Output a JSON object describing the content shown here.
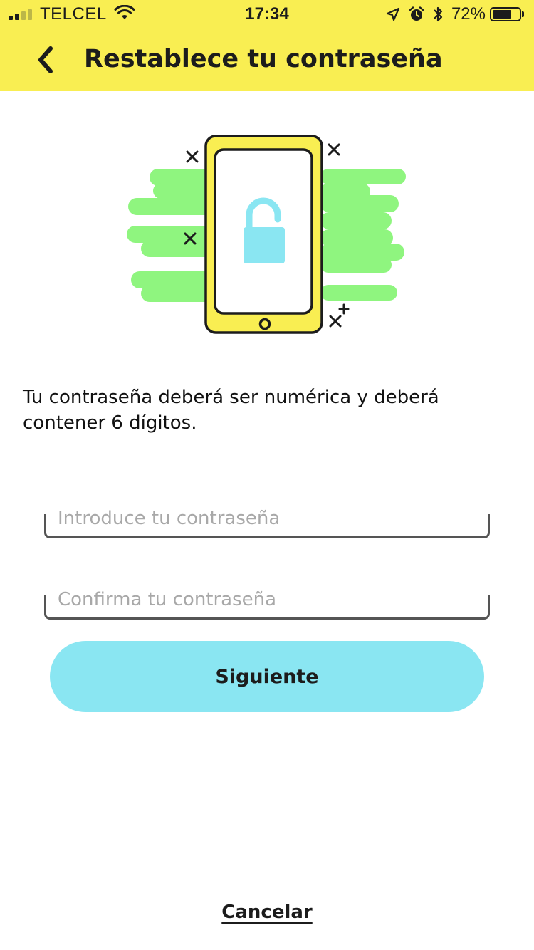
{
  "status_bar": {
    "carrier": "TELCEL",
    "time": "17:34",
    "battery_percent_label": "72%",
    "battery_level": 0.72,
    "signal_bars_filled": 2,
    "signal_bars_total": 4,
    "icons": [
      "signal-icon",
      "wifi-icon",
      "location-arrow-icon",
      "alarm-icon",
      "bluetooth-icon",
      "battery-icon"
    ]
  },
  "header": {
    "title": "Restablece tu contraseña",
    "back_icon": "chevron-left-icon",
    "background_color": "#f9ee52"
  },
  "illustration": {
    "description_icon": "unlocked-phone-icon"
  },
  "instructions": "Tu contraseña deberá ser numérica y deberá contener 6 dígitos.",
  "form": {
    "password_placeholder": "Introduce tu contraseña",
    "password_value": "",
    "confirm_placeholder": "Confirma tu contraseña",
    "confirm_value": "",
    "submit_label": "Siguiente",
    "submit_color": "#8ae6f2"
  },
  "footer": {
    "cancel_label": "Cancelar"
  }
}
